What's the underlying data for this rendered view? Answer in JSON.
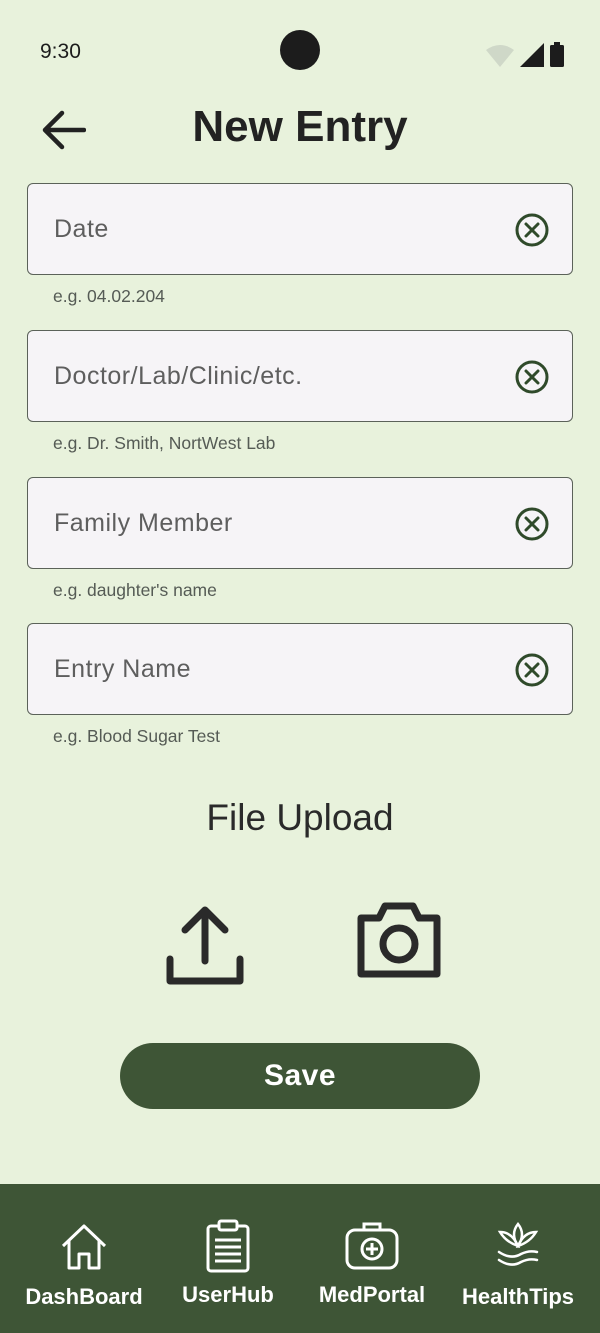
{
  "status_bar": {
    "time": "9:30"
  },
  "header": {
    "title": "New Entry"
  },
  "fields": [
    {
      "placeholder": "Date",
      "helper": "e.g. 04.02.204"
    },
    {
      "placeholder": "Doctor/Lab/Clinic/etc.",
      "helper": "e.g. Dr. Smith, NortWest Lab"
    },
    {
      "placeholder": "Family Member",
      "helper": "e.g. daughter's name"
    },
    {
      "placeholder": "Entry Name",
      "helper": "e.g. Blood Sugar Test"
    }
  ],
  "upload": {
    "title": "File Upload"
  },
  "actions": {
    "save_label": "Save"
  },
  "nav": [
    {
      "label": "DashBoard",
      "icon": "home-icon"
    },
    {
      "label": "UserHub",
      "icon": "clipboard-icon"
    },
    {
      "label": "MedPortal",
      "icon": "medical-kit-icon"
    },
    {
      "label": "HealthTips",
      "icon": "lotus-icon"
    }
  ],
  "colors": {
    "background": "#e8f2dc",
    "accent": "#3e5536",
    "field_bg": "#f6f4f7",
    "icon_green": "#2f4a2a"
  }
}
